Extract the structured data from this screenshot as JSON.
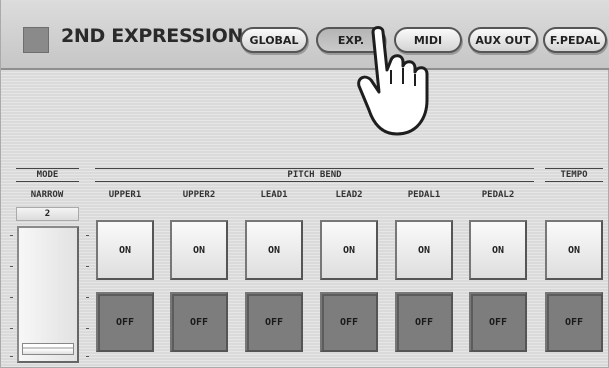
{
  "header": {
    "title": "2ND EXPRESSION",
    "tabs": [
      {
        "label": "GLOBAL",
        "active": false
      },
      {
        "label": "EXP.",
        "active": true
      },
      {
        "label": "MIDI",
        "active": false
      },
      {
        "label": "AUX OUT",
        "active": false
      },
      {
        "label": "F.PEDAL",
        "active": false
      }
    ]
  },
  "sections": {
    "mode": "MODE",
    "pitch_bend": "PITCH BEND",
    "tempo": "TEMPO"
  },
  "mode": {
    "label": "NARROW",
    "value": "2"
  },
  "pitch_bend": {
    "columns": [
      "UPPER1",
      "UPPER2",
      "LEAD1",
      "LEAD2",
      "PEDAL1",
      "PEDAL2"
    ]
  },
  "buttons": {
    "on": "ON",
    "off": "OFF"
  },
  "icons": {
    "pointer": "pointing-hand-icon"
  },
  "colors": {
    "title_square": "#8a8a8a",
    "off_button": "#7d7d7d"
  }
}
